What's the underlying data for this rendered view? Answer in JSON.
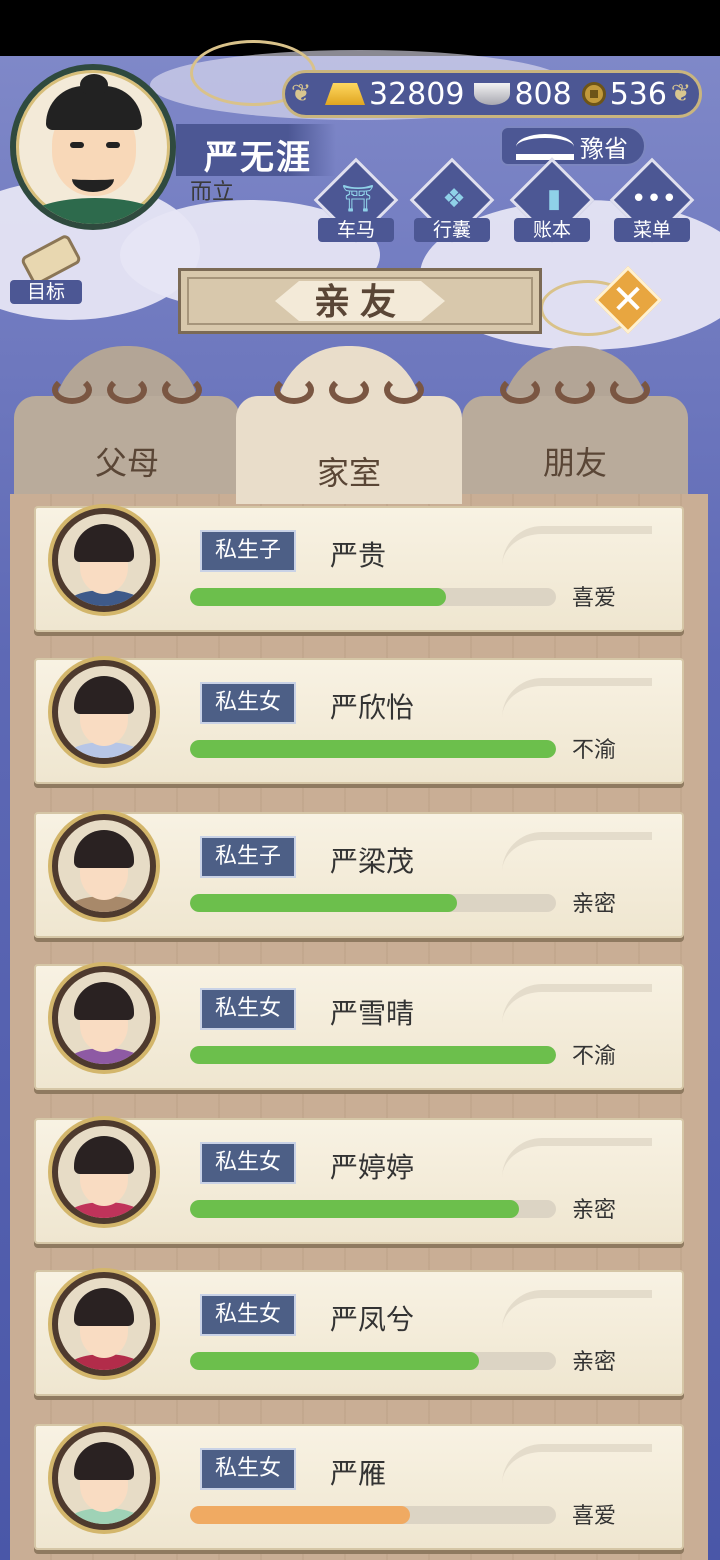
{
  "player": {
    "name": "严无涯",
    "title": "而立"
  },
  "currency": {
    "gold": "32809",
    "silver": "808",
    "copper": "536"
  },
  "province": {
    "label": "豫省"
  },
  "menu": [
    {
      "label": "车马",
      "icon": "carriage-icon"
    },
    {
      "label": "行囊",
      "icon": "bag-icon"
    },
    {
      "label": "账本",
      "icon": "ledger-icon"
    },
    {
      "label": "菜单",
      "icon": "more-icon"
    }
  ],
  "goal": {
    "label": "目标"
  },
  "page_title": "亲友",
  "tabs": [
    {
      "label": "父母",
      "active": false
    },
    {
      "label": "家室",
      "active": true
    },
    {
      "label": "朋友",
      "active": false
    }
  ],
  "relations": [
    {
      "relation": "私生子",
      "name": "严贵",
      "status": "喜爱",
      "affinity": 0.7,
      "bar_color": "#6cbf4c"
    },
    {
      "relation": "私生女",
      "name": "严欣怡",
      "status": "不渝",
      "affinity": 1.0,
      "bar_color": "#6cbf4c"
    },
    {
      "relation": "私生子",
      "name": "严梁茂",
      "status": "亲密",
      "affinity": 0.73,
      "bar_color": "#6cbf4c"
    },
    {
      "relation": "私生女",
      "name": "严雪晴",
      "status": "不渝",
      "affinity": 1.0,
      "bar_color": "#6cbf4c"
    },
    {
      "relation": "私生女",
      "name": "严婷婷",
      "status": "亲密",
      "affinity": 0.9,
      "bar_color": "#6cbf4c"
    },
    {
      "relation": "私生女",
      "name": "严凤兮",
      "status": "亲密",
      "affinity": 0.79,
      "bar_color": "#6cbf4c"
    },
    {
      "relation": "私生女",
      "name": "严雁",
      "status": "喜爱",
      "affinity": 0.6,
      "bar_color": "#f0aa62"
    }
  ]
}
